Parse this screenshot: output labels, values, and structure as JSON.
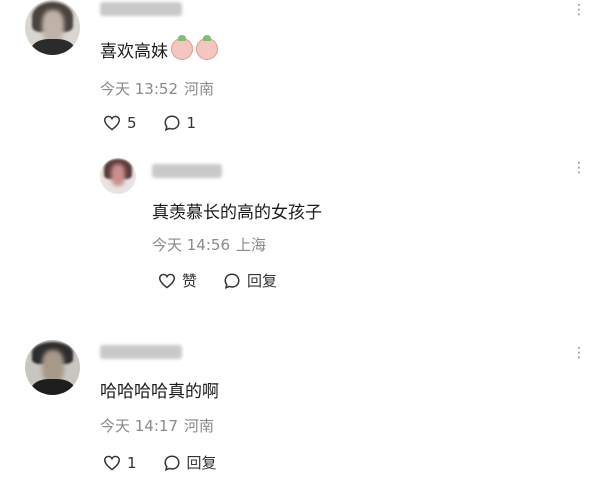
{
  "comments": [
    {
      "content": "喜欢高妹",
      "emojis": [
        "peach-face-emoji",
        "peach-face-emoji"
      ],
      "time": "今天 13:52",
      "location": "河南",
      "likes": "5",
      "replies": "1",
      "more": "⋮"
    },
    {
      "content": "真羡慕长的高的女孩子",
      "time": "今天 14:56",
      "location": "上海",
      "like_label": "赞",
      "reply_label": "回复",
      "more": "⋮"
    },
    {
      "content": "哈哈哈哈真的啊",
      "time": "今天 14:17",
      "location": "河南",
      "likes": "1",
      "reply_label": "回复",
      "more": "⋮"
    }
  ]
}
